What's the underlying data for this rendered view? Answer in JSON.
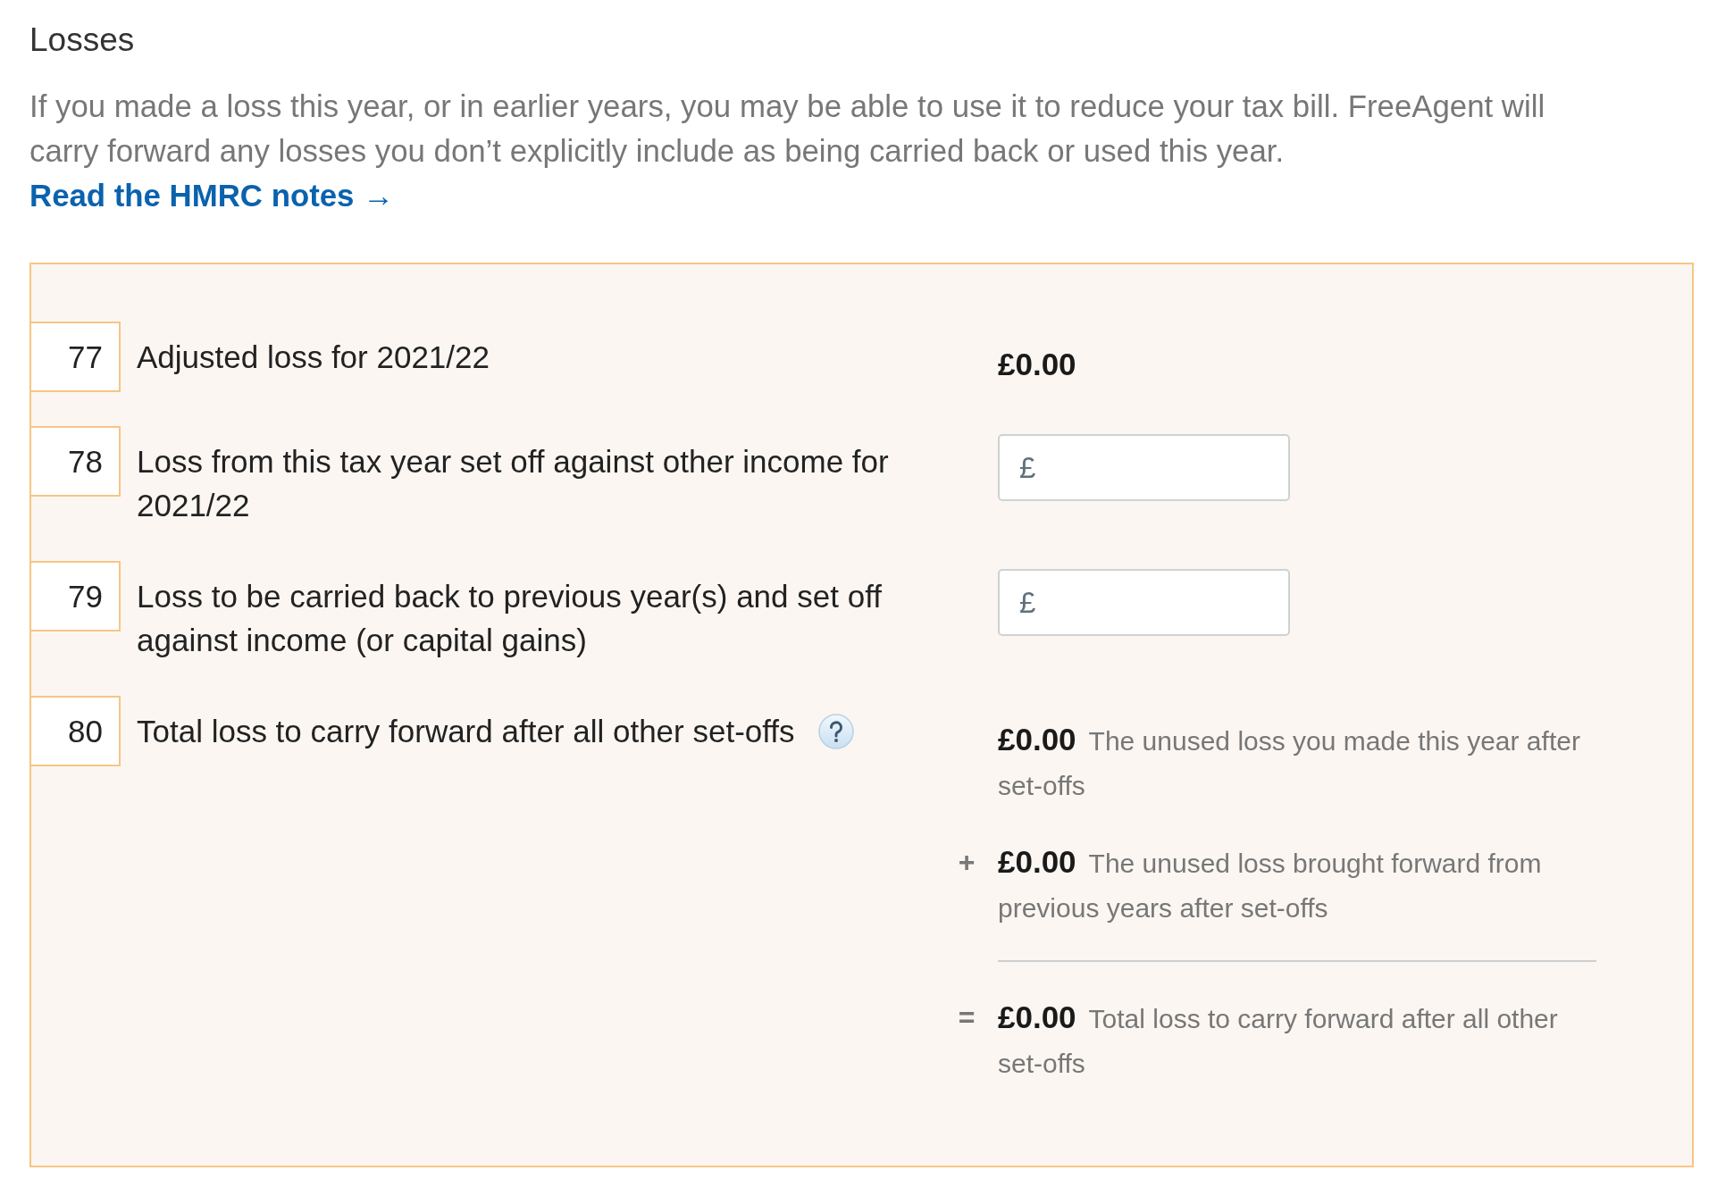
{
  "section": {
    "title": "Losses",
    "intro": "If you made a loss this year, or in earlier years, you may be able to use it to reduce your tax bill. FreeAgent will carry forward any losses you don’t explicitly include as being carried back or used this year.",
    "link": "Read the HMRC notes →"
  },
  "boxes": [
    {
      "number": "77",
      "label": "Adjusted loss for 2021/22",
      "kind": "amount",
      "amount": "£0.00"
    },
    {
      "number": "78",
      "label": "Loss from this tax year set off against other income for 2021/22",
      "kind": "input",
      "prefix": "£"
    },
    {
      "number": "79",
      "label": "Loss to be carried back to previous year(s) and set off against income (or capital gains)",
      "kind": "input",
      "prefix": "£"
    },
    {
      "number": "80",
      "label": "Total loss to carry forward after all other set-offs",
      "kind": "summary",
      "help": true,
      "summary": [
        {
          "kind": "term",
          "amount": "£0.00",
          "text": "The unused loss you made this year after set-offs"
        },
        {
          "kind": "term",
          "operator": "+",
          "amount": "£0.00",
          "text": "The unused loss brought forward from previous years after set-offs"
        },
        {
          "kind": "total",
          "operator": "=",
          "amount": "£0.00",
          "text": "Total loss to carry forward after all other set-offs"
        }
      ]
    }
  ]
}
